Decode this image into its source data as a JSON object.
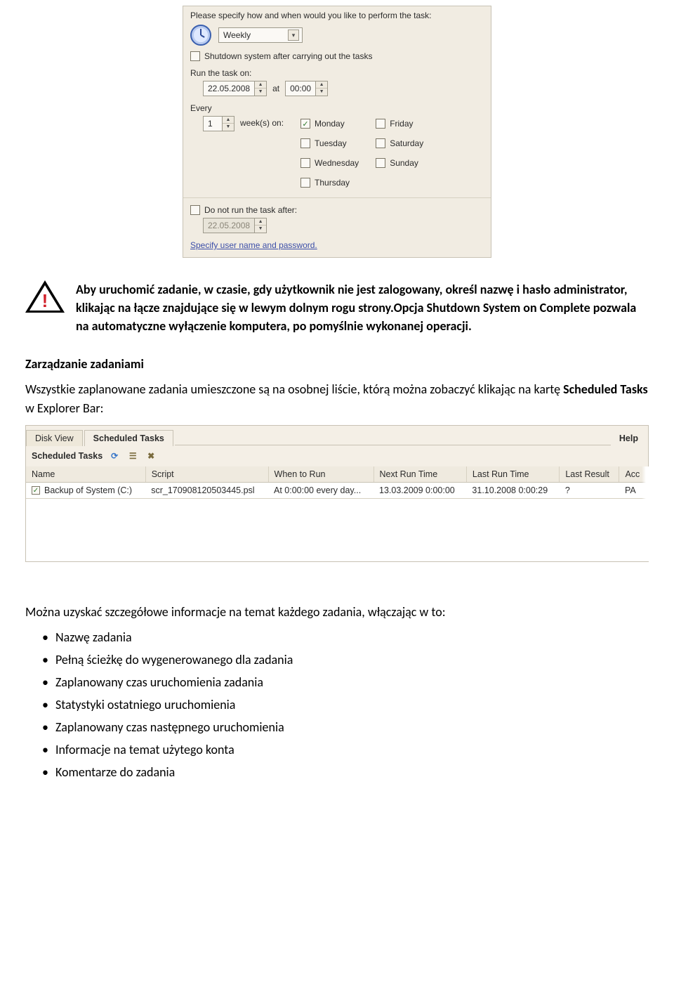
{
  "schedule_panel": {
    "prompt": "Please specify how and when would you like to perform the task:",
    "frequency": "Weekly",
    "shutdown_label": "Shutdown system after carrying out the tasks",
    "shutdown_checked": false,
    "run_on_label": "Run the task on:",
    "run_date": "22.05.2008",
    "at_label": "at",
    "run_time": "00:00",
    "every_label": "Every",
    "every_count": "1",
    "weeks_on_label": "week(s) on:",
    "days": {
      "monday": {
        "label": "Monday",
        "checked": true
      },
      "tuesday": {
        "label": "Tuesday",
        "checked": false
      },
      "wednesday": {
        "label": "Wednesday",
        "checked": false
      },
      "thursday": {
        "label": "Thursday",
        "checked": false
      },
      "friday": {
        "label": "Friday",
        "checked": false
      },
      "saturday": {
        "label": "Saturday",
        "checked": false
      },
      "sunday": {
        "label": "Sunday",
        "checked": false
      }
    },
    "not_after_label": "Do not run the task after:",
    "not_after_checked": false,
    "not_after_date": "22.05.2008",
    "specify_link": "Specify user name and password."
  },
  "alert_text": "Aby uruchomić zadanie, w czasie, gdy użytkownik nie jest zalogowany, określ nazwę i hasło administrator, klikając na łącze znajdujące się w lewym dolnym rogu strony.Opcja Shutdown System on Complete pozwala na automatyczne wyłączenie komputera, po pomyślnie wykonanej operacji.",
  "heading_manage": "Zarządzanie zadaniami",
  "para_list_intro_1": "Wszystkie zaplanowane zadania umieszczone są na osobnej liście, którą można zobaczyć klikając na kartę ",
  "para_list_intro_bold": "Scheduled Tasks",
  "para_list_intro_2": " w Explorer Bar:",
  "explorer": {
    "tabs": {
      "disk_view": "Disk View",
      "scheduled": "Scheduled Tasks",
      "help": "Help"
    },
    "subheader": "Scheduled Tasks",
    "columns": {
      "name": "Name",
      "script": "Script",
      "when": "When to Run",
      "next": "Next Run Time",
      "last": "Last Run Time",
      "result": "Last Result",
      "acc": "Acc"
    },
    "row": {
      "checked": true,
      "name": "Backup of System (C:)",
      "script": "scr_170908120503445.psl",
      "when": "At 0:00:00 every day...",
      "next": "13.03.2009 0:00:00",
      "last": "31.10.2008 0:00:29",
      "result": "?",
      "acc": "PA"
    }
  },
  "detail_lead": "Można uzyskać szczegółowe informacje na temat każdego zadania, włączając w to:",
  "bullets": {
    "b1": "Nazwę zadania",
    "b2": "Pełną ścieżkę do wygenerowanego dla zadania",
    "b3": "Zaplanowany czas uruchomienia zadania",
    "b4": "Statystyki ostatniego uruchomienia",
    "b5": "Zaplanowany czas następnego uruchomienia",
    "b6": "Informacje na temat użytego konta",
    "b7": "Komentarze do zadania"
  }
}
